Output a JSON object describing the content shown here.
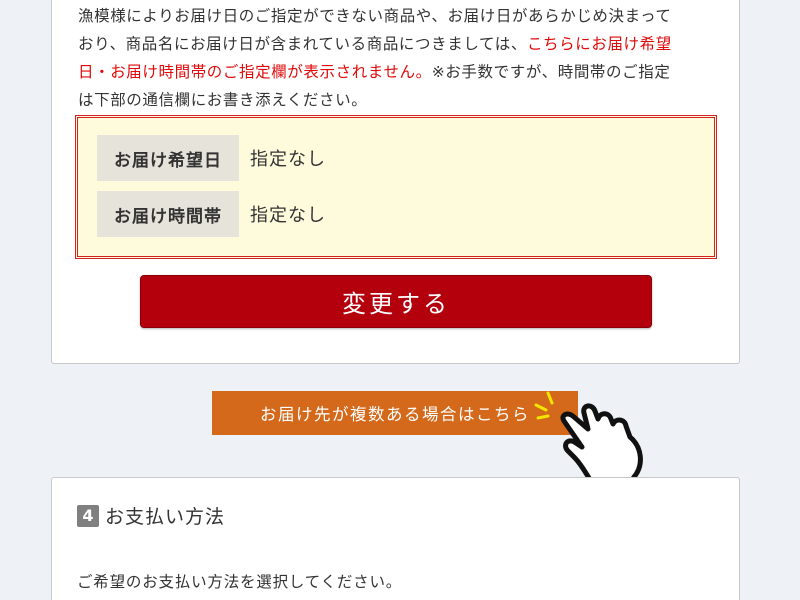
{
  "notice": {
    "line1": "漁模様によりお届け日のご指定ができない商品や、お届け日があらかじめ決まって",
    "line2_a": "おり、商品名にお届け日が含まれている商品につきましては、",
    "line2_red": "こちらにお届け希望",
    "line3_red": "日・お届け時間帯のご指定欄が表示されません。",
    "line3_b": "※お手数ですが、時間帯のご指定",
    "line4": "は下部の通信欄にお書き添えください。"
  },
  "delivery": {
    "date_label": "お届け希望日",
    "date_value": "指定なし",
    "time_label": "お届け時間帯",
    "time_value": "指定なし"
  },
  "buttons": {
    "change_label": "変更する",
    "multiple_destinations_label": "お届け先が複数ある場合はこちら"
  },
  "payment": {
    "step_number": "4",
    "title": "お支払い方法",
    "description": "ご希望のお支払い方法を選択してください。"
  },
  "colors": {
    "change_button": "#b3000c",
    "multiple_button": "#d4691b",
    "notice_red": "#e10a0a",
    "box_border": "#d42222",
    "box_background": "#fefbdd"
  },
  "icons": {
    "pointer": "pointing-hand-icon"
  }
}
